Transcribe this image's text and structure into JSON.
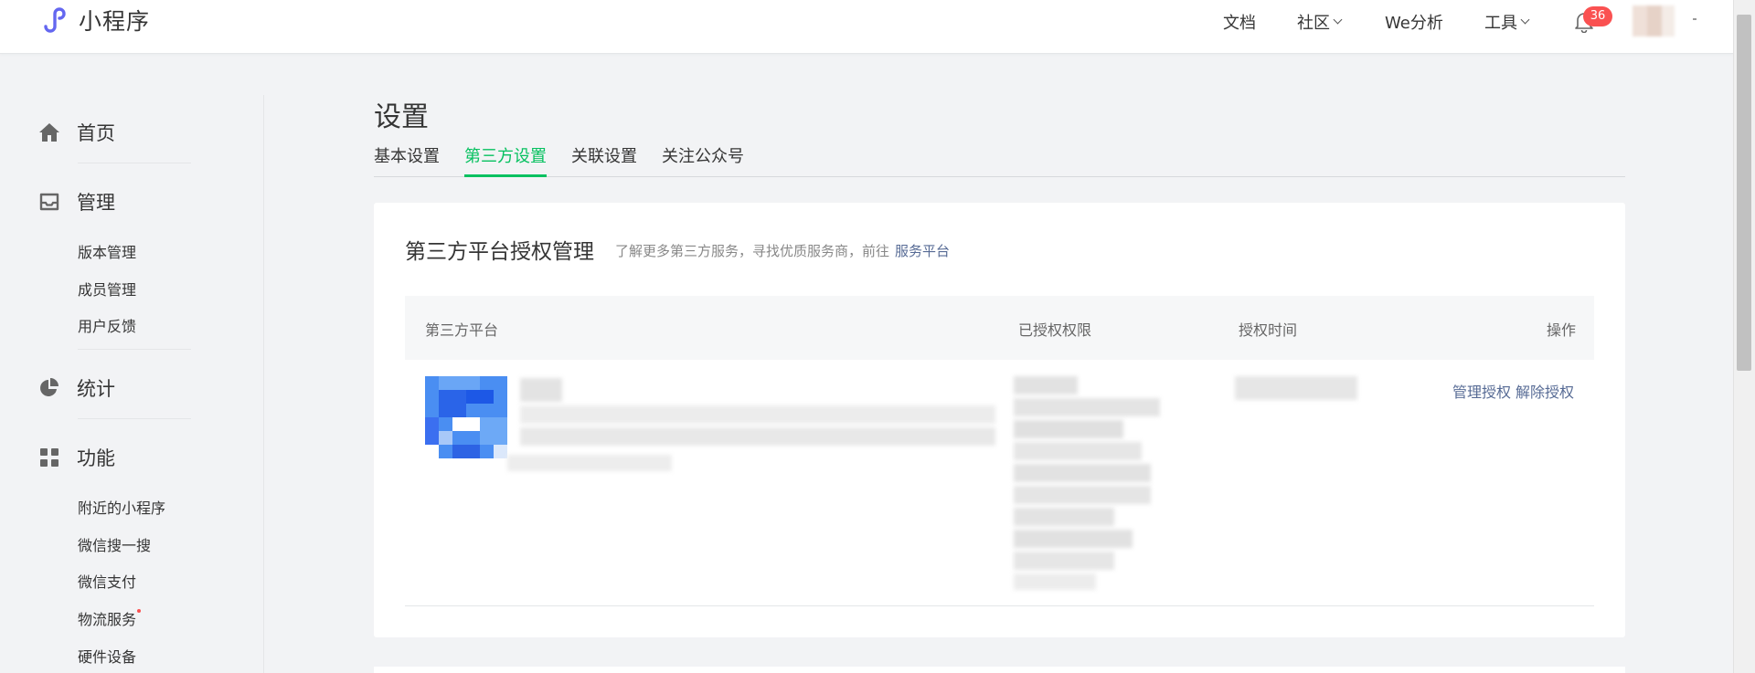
{
  "header": {
    "brand": "小程序",
    "nav": {
      "docs": "文档",
      "community": "社区",
      "analytics": "We分析",
      "tools": "工具"
    },
    "notification_count": "36"
  },
  "sidebar": {
    "home": "首页",
    "manage": "管理",
    "manage_items": [
      "版本管理",
      "成员管理",
      "用户反馈"
    ],
    "stats": "统计",
    "features": "功能",
    "feature_items": [
      "附近的小程序",
      "微信搜一搜",
      "微信支付",
      "物流服务",
      "硬件设备"
    ]
  },
  "page": {
    "title": "设置",
    "tabs": [
      "基本设置",
      "第三方设置",
      "关联设置",
      "关注公众号"
    ],
    "active_tab": "第三方设置"
  },
  "card": {
    "title": "第三方平台授权管理",
    "desc": "了解更多第三方服务，寻找优质服务商，前往",
    "link": "服务平台",
    "table": {
      "headers": [
        "第三方平台",
        "已授权权限",
        "授权时间",
        "操作"
      ],
      "rows": [
        {
          "actions": [
            "管理授权",
            "解除授权"
          ]
        }
      ]
    }
  },
  "colors": {
    "accent_green": "#07c160",
    "link_blue": "#576b95",
    "badge_red": "#fa5151"
  }
}
